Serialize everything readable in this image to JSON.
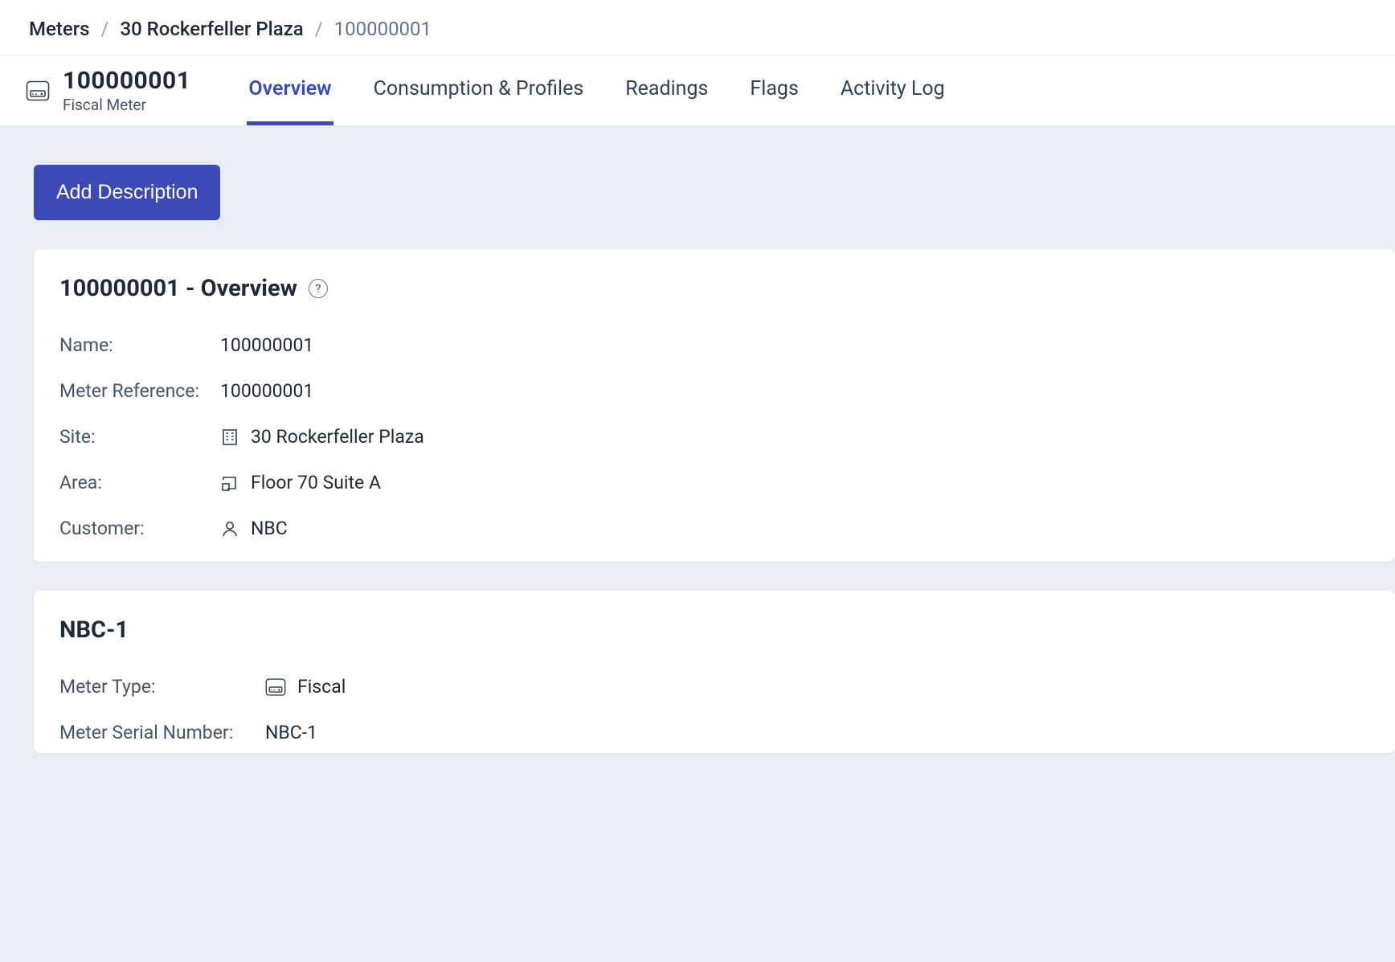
{
  "breadcrumb": {
    "root": "Meters",
    "site": "30 Rockerfeller Plaza",
    "current": "100000001"
  },
  "header": {
    "title": "100000001",
    "subtitle": "Fiscal Meter"
  },
  "tabs": {
    "overview": "Overview",
    "consumption": "Consumption & Profiles",
    "readings": "Readings",
    "flags": "Flags",
    "activity": "Activity Log"
  },
  "actions": {
    "add_description": "Add Description"
  },
  "overview_card": {
    "title": "100000001 - Overview",
    "labels": {
      "name": "Name:",
      "meter_reference": "Meter Reference:",
      "site": "Site:",
      "area": "Area:",
      "customer": "Customer:"
    },
    "values": {
      "name": "100000001",
      "meter_reference": "100000001",
      "site": "30 Rockerfeller Plaza",
      "area": "Floor 70 Suite A",
      "customer": "NBC"
    }
  },
  "details_card": {
    "title": "NBC-1",
    "labels": {
      "meter_type": "Meter Type:",
      "meter_serial": "Meter Serial Number:"
    },
    "values": {
      "meter_type": "Fiscal",
      "meter_serial": "NBC-1"
    }
  }
}
